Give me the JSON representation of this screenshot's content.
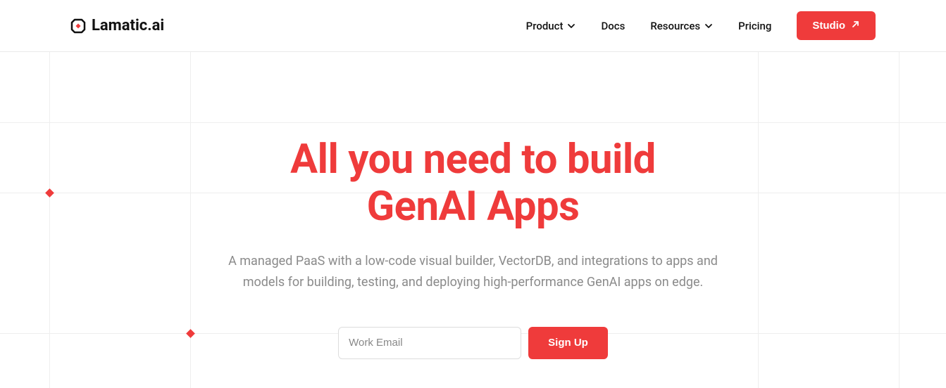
{
  "brand": {
    "name": "Lamatic.ai"
  },
  "nav": {
    "items": [
      {
        "label": "Product",
        "hasDropdown": true
      },
      {
        "label": "Docs",
        "hasDropdown": false
      },
      {
        "label": "Resources",
        "hasDropdown": true
      },
      {
        "label": "Pricing",
        "hasDropdown": false
      }
    ],
    "cta": "Studio"
  },
  "hero": {
    "title_line1": "All you need to build",
    "title_line2": "GenAI Apps",
    "subtitle": "A managed PaaS with a low-code visual builder, VectorDB, and integrations to apps and models for building, testing, and deploying high-performance GenAI apps on edge."
  },
  "signup": {
    "placeholder": "Work Email",
    "button": "Sign Up"
  },
  "colors": {
    "accent": "#ef3b3b"
  }
}
